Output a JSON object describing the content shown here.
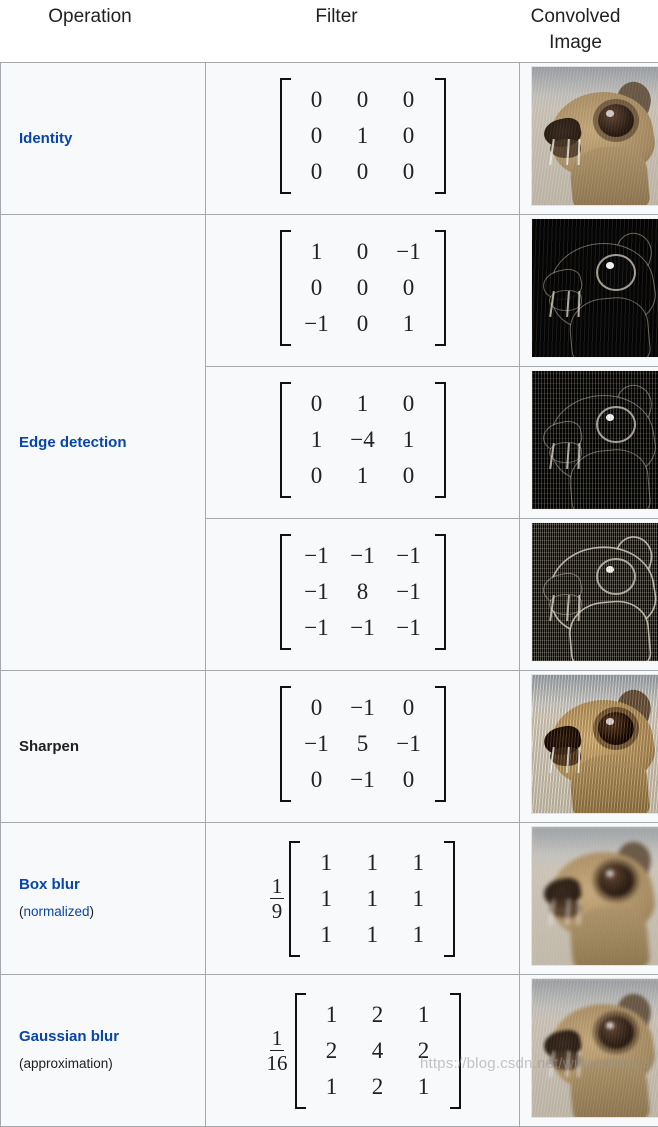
{
  "headers": {
    "operation": "Operation",
    "filter": "Filter",
    "image_line1": "Convolved",
    "image_line2": "Image"
  },
  "colors": {
    "link_blue": "#0645ad",
    "text_black": "#202122",
    "cell_background": "#f8f9fa",
    "border": "#a2a9b1"
  },
  "watermark": "https://blog.csdn.net/wumian0123",
  "rows": [
    {
      "name": "Identity",
      "name_style": "link",
      "sub": null,
      "filters": [
        {
          "scalar": null,
          "matrix": [
            [
              "0",
              "0",
              "0"
            ],
            [
              "0",
              "1",
              "0"
            ],
            [
              "0",
              "0",
              "0"
            ]
          ],
          "image": "identity-convolved-image"
        }
      ]
    },
    {
      "name": "Edge detection",
      "name_style": "link",
      "sub": null,
      "filters": [
        {
          "scalar": null,
          "matrix": [
            [
              "1",
              "0",
              "−1"
            ],
            [
              "0",
              "0",
              "0"
            ],
            [
              "−1",
              "0",
              "1"
            ]
          ],
          "image": "edge-detection-convolved-image-1"
        },
        {
          "scalar": null,
          "matrix": [
            [
              "0",
              "1",
              "0"
            ],
            [
              "1",
              "−4",
              "1"
            ],
            [
              "0",
              "1",
              "0"
            ]
          ],
          "image": "edge-detection-convolved-image-2"
        },
        {
          "scalar": null,
          "matrix": [
            [
              "−1",
              "−1",
              "−1"
            ],
            [
              "−1",
              "8",
              "−1"
            ],
            [
              "−1",
              "−1",
              "−1"
            ]
          ],
          "image": "edge-detection-convolved-image-3"
        }
      ]
    },
    {
      "name": "Sharpen",
      "name_style": "plain",
      "sub": null,
      "filters": [
        {
          "scalar": null,
          "matrix": [
            [
              "0",
              "−1",
              "0"
            ],
            [
              "−1",
              "5",
              "−1"
            ],
            [
              "0",
              "−1",
              "0"
            ]
          ],
          "image": "sharpen-convolved-image"
        }
      ]
    },
    {
      "name": "Box blur",
      "name_style": "link",
      "sub": {
        "open": "(",
        "link_text": "normalized",
        "close": ")",
        "link": true
      },
      "filters": [
        {
          "scalar": {
            "numerator": "1",
            "denominator": "9"
          },
          "matrix": [
            [
              "1",
              "1",
              "1"
            ],
            [
              "1",
              "1",
              "1"
            ],
            [
              "1",
              "1",
              "1"
            ]
          ],
          "image": "box-blur-convolved-image"
        }
      ]
    },
    {
      "name": "Gaussian blur",
      "name_style": "link",
      "sub": {
        "open": "(",
        "link_text": "approximation",
        "close": ")",
        "link": false
      },
      "filters": [
        {
          "scalar": {
            "numerator": "1",
            "denominator": "16"
          },
          "matrix": [
            [
              "1",
              "2",
              "1"
            ],
            [
              "2",
              "4",
              "2"
            ],
            [
              "1",
              "2",
              "1"
            ]
          ],
          "image": "gaussian-blur-convolved-image"
        }
      ]
    }
  ]
}
